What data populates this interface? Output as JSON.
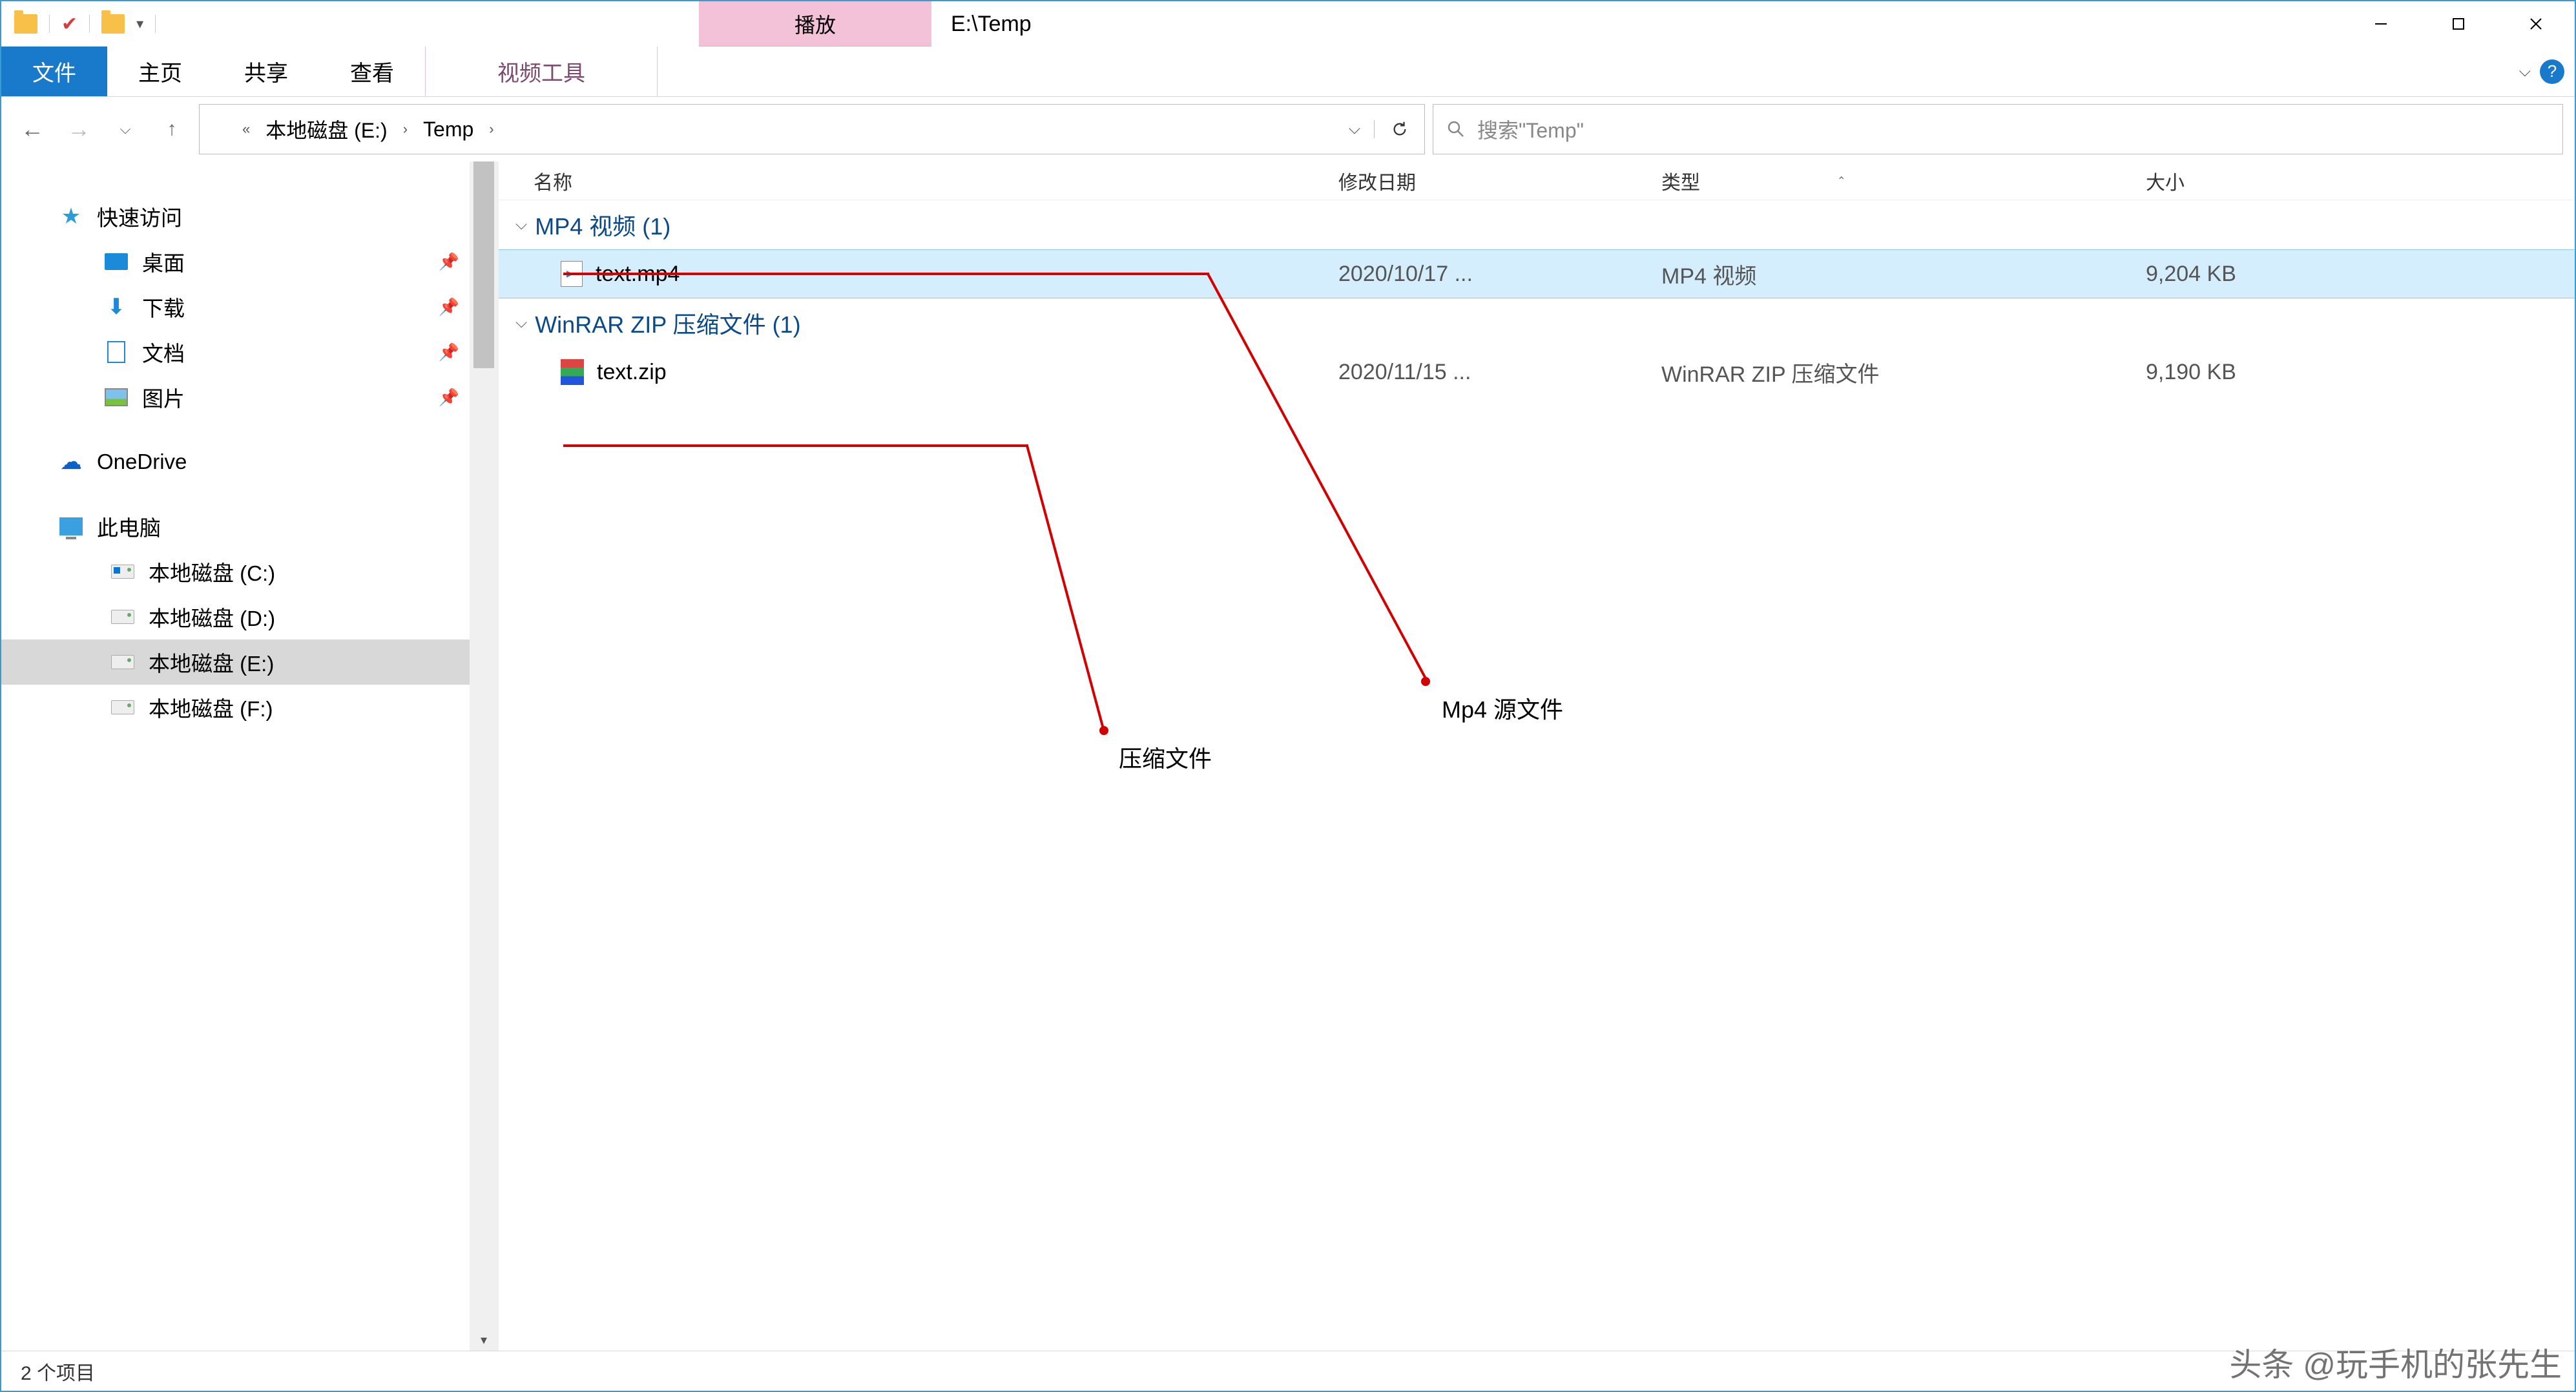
{
  "window": {
    "title": "E:\\Temp"
  },
  "titlebar": {
    "context_tab": "播放"
  },
  "ribbon": {
    "file": "文件",
    "tabs": [
      "主页",
      "共享",
      "查看"
    ],
    "context": "视频工具"
  },
  "nav": {
    "breadcrumb_prefix": "«",
    "crumbs": [
      "本地磁盘 (E:)",
      "Temp"
    ]
  },
  "search": {
    "placeholder": "搜索\"Temp\""
  },
  "sidebar": {
    "quick_access": "快速访问",
    "desktop": "桌面",
    "downloads": "下载",
    "documents": "文档",
    "pictures": "图片",
    "onedrive": "OneDrive",
    "this_pc": "此电脑",
    "drives": [
      "本地磁盘 (C:)",
      "本地磁盘 (D:)",
      "本地磁盘 (E:)",
      "本地磁盘 (F:)"
    ]
  },
  "columns": {
    "name": "名称",
    "date": "修改日期",
    "type": "类型",
    "size": "大小"
  },
  "groups": [
    {
      "label": "MP4 视频 (1)",
      "files": [
        {
          "name": "text.mp4",
          "date": "2020/10/17 ...",
          "type": "MP4 视频",
          "size": "9,204 KB",
          "icon": "mp4"
        }
      ]
    },
    {
      "label": "WinRAR ZIP 压缩文件 (1)",
      "files": [
        {
          "name": "text.zip",
          "date": "2020/11/15 ...",
          "type": "WinRAR ZIP 压缩文件",
          "size": "9,190 KB",
          "icon": "zip"
        }
      ]
    }
  ],
  "status": {
    "items": "2 个项目"
  },
  "annotations": {
    "zip_label": "压缩文件",
    "mp4_label": "Mp4 源文件"
  },
  "watermark": "头条 @玩手机的张先生"
}
